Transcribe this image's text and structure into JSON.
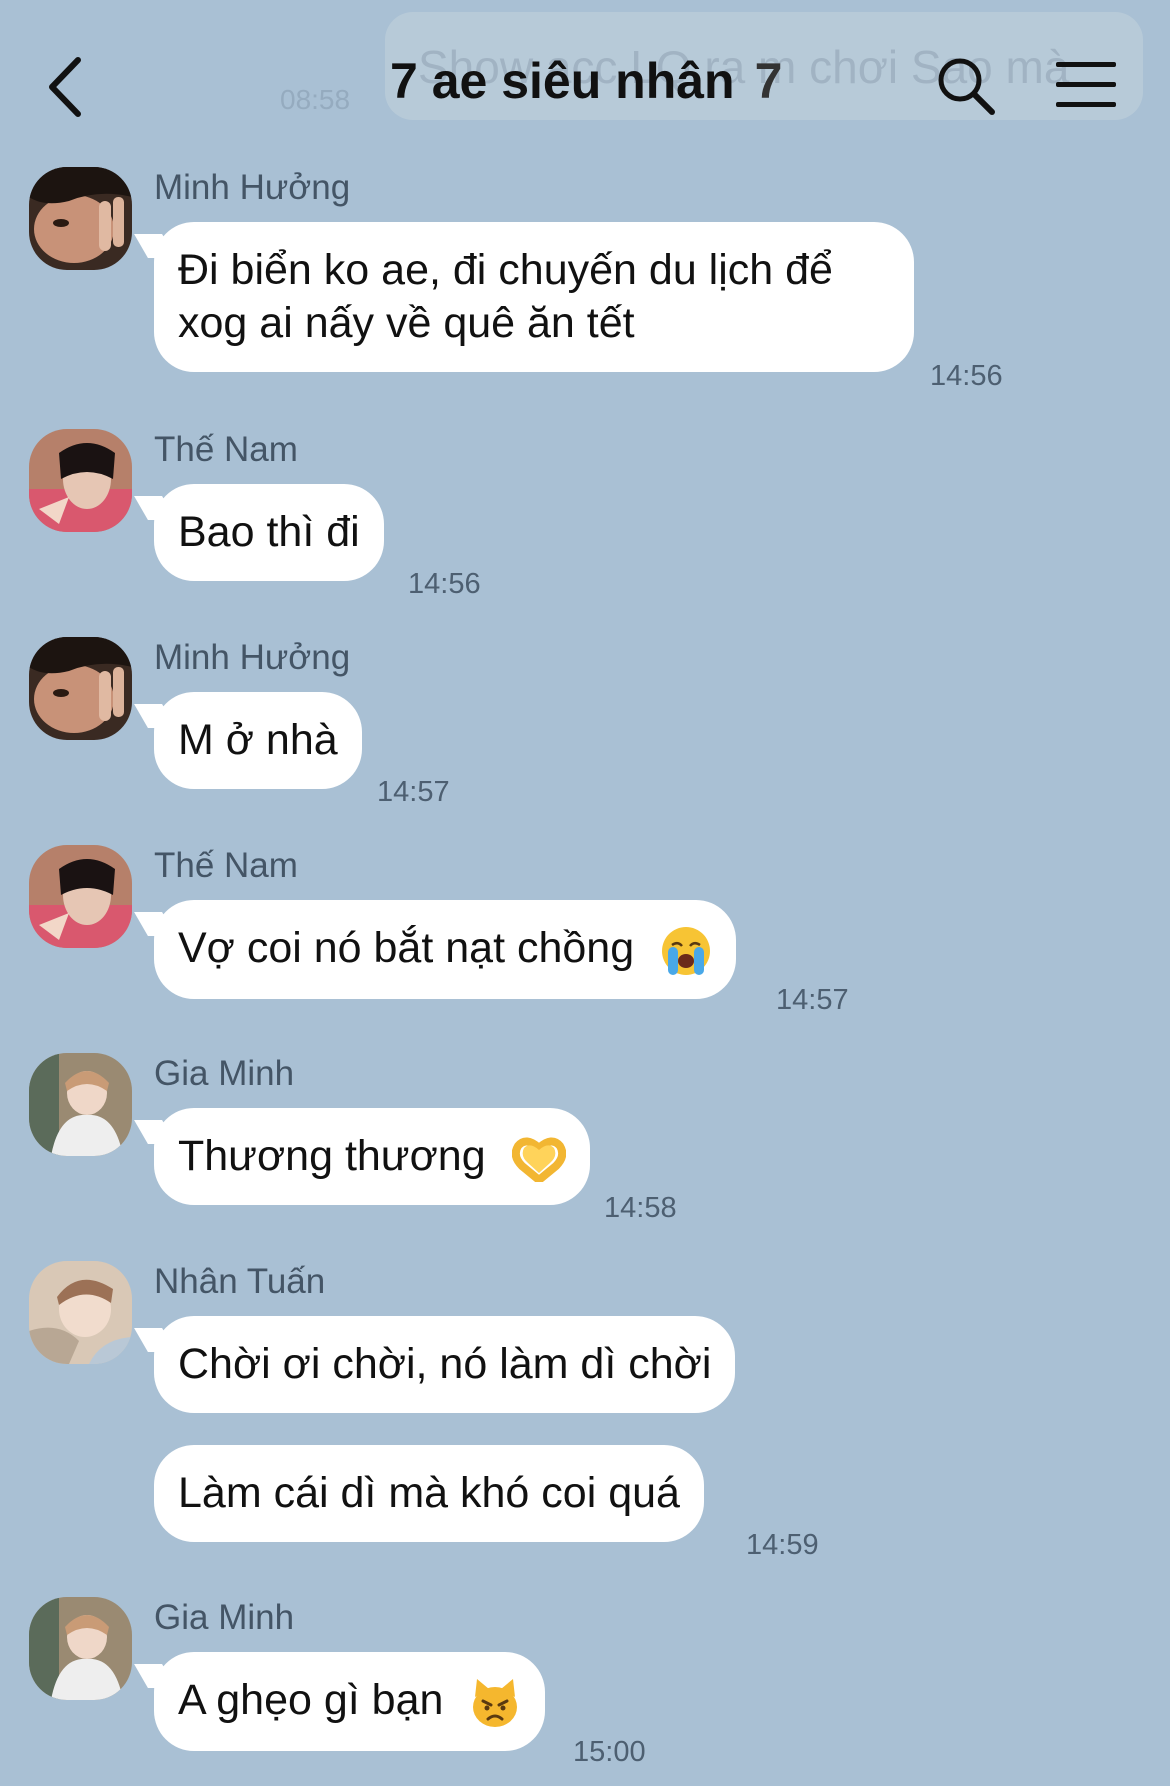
{
  "header": {
    "title": "7 ae siêu nhân",
    "member_count": "7",
    "back_icon": "chevron-left-icon",
    "search_icon": "search-icon",
    "menu_icon": "hamburger-menu-icon",
    "faded_preview_text": "Show acc LQ ra m chơi Sao mà",
    "faded_preview_time": "08:58"
  },
  "colors": {
    "background": "#a9c0d4",
    "bubble": "#ffffff",
    "sender_name": "#445566",
    "timestamp": "#4d5f71"
  },
  "messages": [
    {
      "sender": "Minh Hưởng",
      "avatar": "minh-huong-avatar",
      "bubbles": [
        {
          "line1": "Đi biển ko ae, đi chuyến du lịch để",
          "line2": "xog ai nấy về quê ăn tết"
        }
      ],
      "time": "14:56"
    },
    {
      "sender": "Thế Nam",
      "avatar": "the-nam-avatar",
      "bubbles": [
        {
          "text": "Bao thì đi"
        }
      ],
      "time": "14:56"
    },
    {
      "sender": "Minh Hưởng",
      "avatar": "minh-huong-avatar",
      "bubbles": [
        {
          "text": "M ở nhà"
        }
      ],
      "time": "14:57"
    },
    {
      "sender": "Thế Nam",
      "avatar": "the-nam-avatar",
      "bubbles": [
        {
          "text": "Vợ coi nó bắt nạt chồng",
          "emoji": "loudly-crying-face-emoji"
        }
      ],
      "time": "14:57"
    },
    {
      "sender": "Gia Minh",
      "avatar": "gia-minh-avatar",
      "bubbles": [
        {
          "text": "Thương thương",
          "emoji": "heart-hands-emoji"
        }
      ],
      "time": "14:58"
    },
    {
      "sender": "Nhân Tuấn",
      "avatar": "nhan-tuan-avatar",
      "bubbles": [
        {
          "text": "Chời ơi chời, nó làm dì chời"
        },
        {
          "text": "Làm cái dì mà khó coi quá"
        }
      ],
      "time": "14:59"
    },
    {
      "sender": "Gia Minh",
      "avatar": "gia-minh-avatar",
      "bubbles": [
        {
          "text": "A ghẹo gì bạn",
          "emoji": "pouting-cat-emoji"
        }
      ],
      "time": "15:00"
    }
  ]
}
